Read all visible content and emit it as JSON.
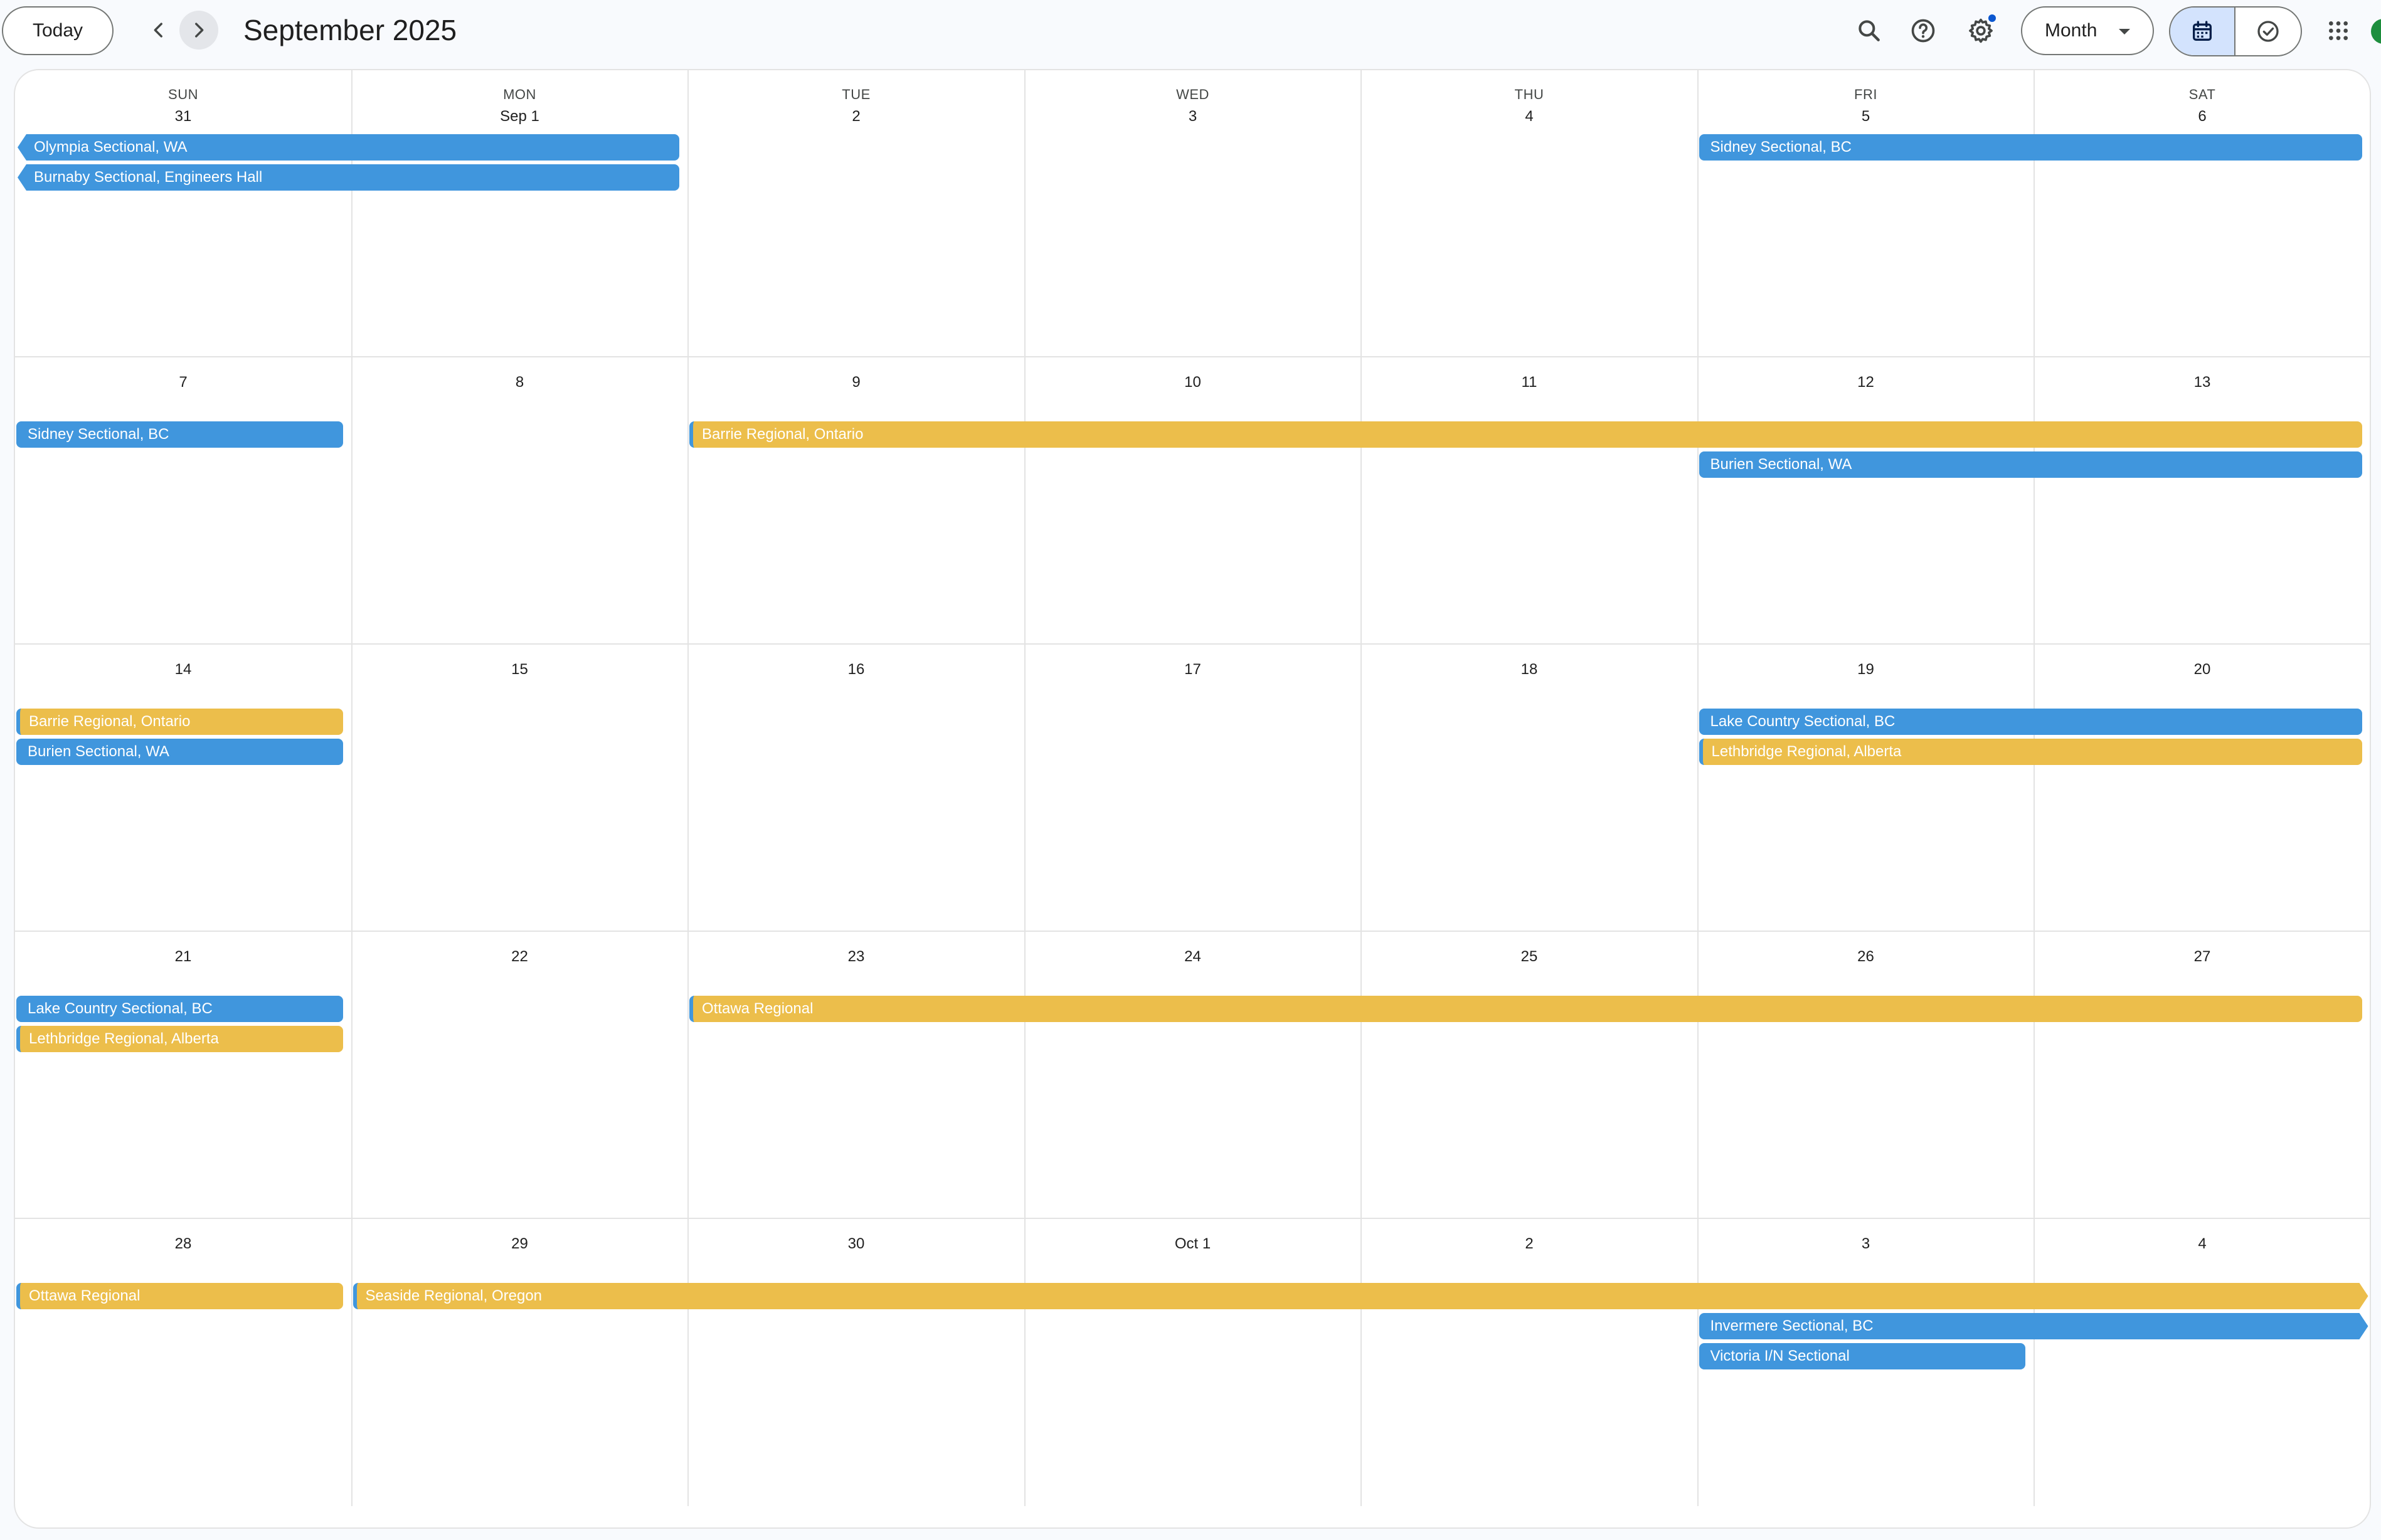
{
  "header": {
    "today_label": "Today",
    "title": "September 2025",
    "view_label": "Month"
  },
  "icons": {
    "prev": "chevron-left-icon",
    "next": "chevron-right-icon",
    "search": "search-icon",
    "help": "help-icon",
    "settings": "gear-icon",
    "calendar_view": "calendar-icon",
    "tasks_view": "check-circle-icon",
    "apps": "apps-grid-icon"
  },
  "colors": {
    "blue_event": "#4096dd",
    "yellow_event": "#ecbe4b",
    "selected_segment": "#d3e3fd",
    "notification_dot": "#0b57d0"
  },
  "weekdays": [
    "SUN",
    "MON",
    "TUE",
    "WED",
    "THU",
    "FRI",
    "SAT"
  ],
  "weeks": [
    {
      "days": [
        "31",
        "Sep 1",
        "2",
        "3",
        "4",
        "5",
        "6"
      ],
      "events": [
        {
          "title": "Olympia Sectional, WA",
          "color": "blue",
          "start": 0,
          "span": 2,
          "lane": 0,
          "continues_left": true
        },
        {
          "title": "Burnaby Sectional, Engineers Hall",
          "color": "blue",
          "start": 0,
          "span": 2,
          "lane": 1,
          "continues_left": true
        },
        {
          "title": "Sidney Sectional, BC",
          "color": "blue",
          "start": 5,
          "span": 2,
          "lane": 0
        }
      ]
    },
    {
      "days": [
        "7",
        "8",
        "9",
        "10",
        "11",
        "12",
        "13"
      ],
      "events": [
        {
          "title": "Sidney Sectional, BC",
          "color": "blue",
          "start": 0,
          "span": 1,
          "lane": 0
        },
        {
          "title": "Barrie Regional, Ontario",
          "color": "yellow",
          "start": 2,
          "span": 5,
          "lane": 0,
          "accent": true
        },
        {
          "title": "Burien Sectional, WA",
          "color": "blue",
          "start": 5,
          "span": 2,
          "lane": 1
        }
      ]
    },
    {
      "days": [
        "14",
        "15",
        "16",
        "17",
        "18",
        "19",
        "20"
      ],
      "events": [
        {
          "title": "Barrie Regional, Ontario",
          "color": "yellow",
          "start": 0,
          "span": 1,
          "lane": 0,
          "accent": true
        },
        {
          "title": "Burien Sectional, WA",
          "color": "blue",
          "start": 0,
          "span": 1,
          "lane": 1
        },
        {
          "title": "Lake Country Sectional, BC",
          "color": "blue",
          "start": 5,
          "span": 2,
          "lane": 0
        },
        {
          "title": "Lethbridge Regional, Alberta",
          "color": "yellow",
          "start": 5,
          "span": 2,
          "lane": 1,
          "accent": true
        }
      ]
    },
    {
      "days": [
        "21",
        "22",
        "23",
        "24",
        "25",
        "26",
        "27"
      ],
      "events": [
        {
          "title": "Lake Country Sectional, BC",
          "color": "blue",
          "start": 0,
          "span": 1,
          "lane": 0
        },
        {
          "title": "Lethbridge Regional, Alberta",
          "color": "yellow",
          "start": 0,
          "span": 1,
          "lane": 1,
          "accent": true
        },
        {
          "title": "Ottawa Regional",
          "color": "yellow",
          "start": 2,
          "span": 5,
          "lane": 0,
          "accent": true
        }
      ]
    },
    {
      "days": [
        "28",
        "29",
        "30",
        "Oct 1",
        "2",
        "3",
        "4"
      ],
      "events": [
        {
          "title": "Ottawa Regional",
          "color": "yellow",
          "start": 0,
          "span": 1,
          "lane": 0,
          "accent": true
        },
        {
          "title": "Seaside Regional, Oregon",
          "color": "yellow",
          "start": 1,
          "span": 6,
          "lane": 0,
          "accent": true,
          "continues_right": true
        },
        {
          "title": "Invermere Sectional, BC",
          "color": "blue",
          "start": 5,
          "span": 2,
          "lane": 1,
          "continues_right": true
        },
        {
          "title": "Victoria I/N Sectional",
          "color": "blue",
          "start": 5,
          "span": 1,
          "lane": 2
        }
      ]
    }
  ]
}
